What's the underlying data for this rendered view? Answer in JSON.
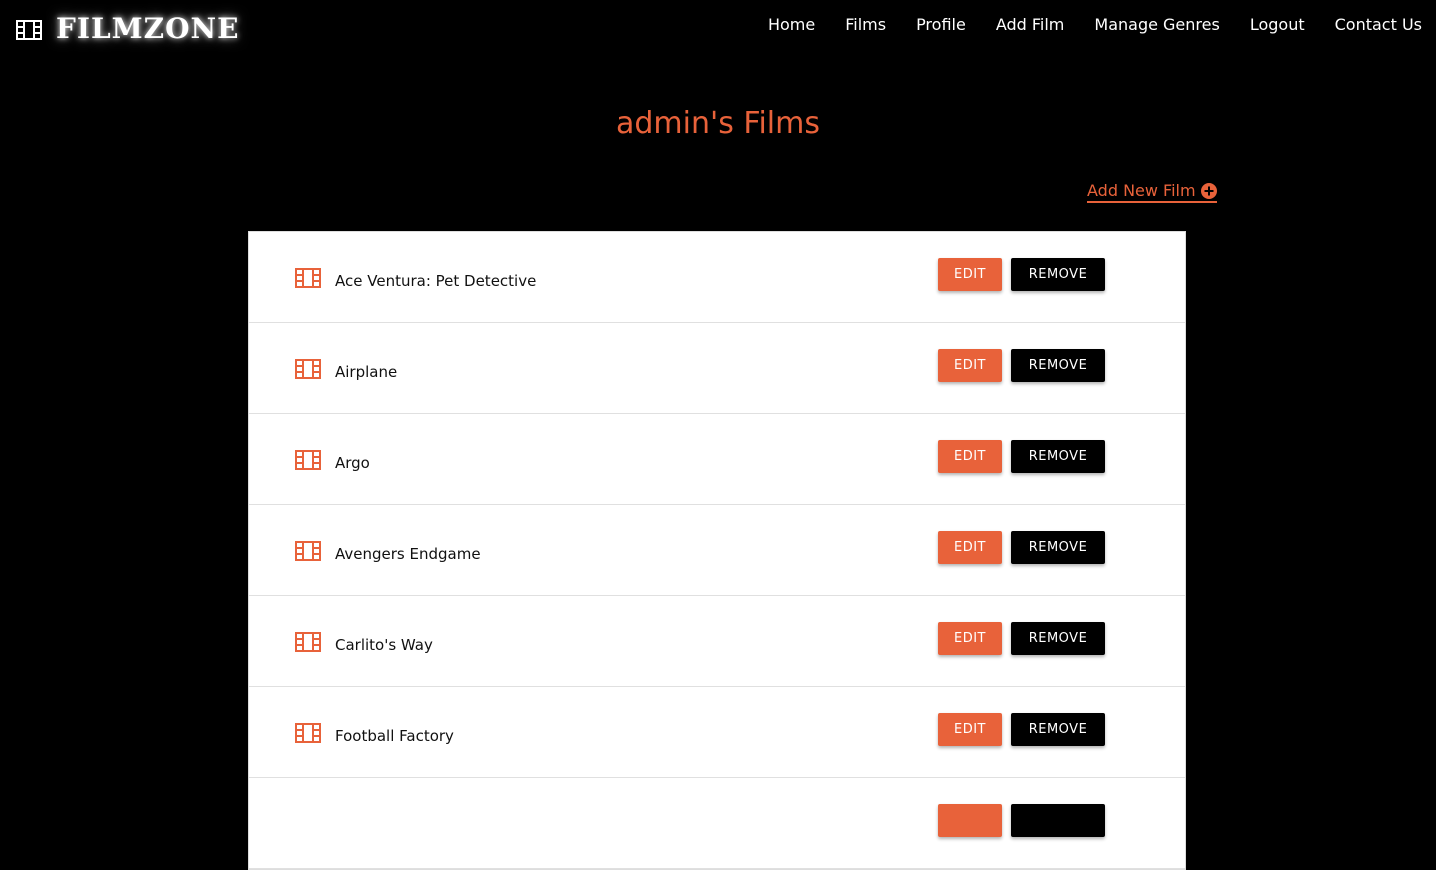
{
  "brand": {
    "name": "FILMZONE",
    "icon": "film-icon"
  },
  "nav": [
    {
      "label": "Home"
    },
    {
      "label": "Films"
    },
    {
      "label": "Profile"
    },
    {
      "label": "Add Film"
    },
    {
      "label": "Manage Genres"
    },
    {
      "label": "Logout"
    },
    {
      "label": "Contact Us"
    }
  ],
  "page": {
    "title": "admin's Films",
    "add_new_label": "Add New Film",
    "add_new_icon": "plus-circle-icon"
  },
  "films": [
    {
      "title": "Ace Ventura: Pet Detective",
      "edit_label": "EDIT",
      "remove_label": "REMOVE"
    },
    {
      "title": "Airplane",
      "edit_label": "EDIT",
      "remove_label": "REMOVE"
    },
    {
      "title": "Argo",
      "edit_label": "EDIT",
      "remove_label": "REMOVE"
    },
    {
      "title": "Avengers Endgame",
      "edit_label": "EDIT",
      "remove_label": "REMOVE"
    },
    {
      "title": "Carlito's Way",
      "edit_label": "EDIT",
      "remove_label": "REMOVE"
    },
    {
      "title": "Football Factory",
      "edit_label": "EDIT",
      "remove_label": "REMOVE"
    },
    {
      "title": "",
      "edit_label": "",
      "remove_label": ""
    }
  ],
  "colors": {
    "accent": "#e8623a",
    "background": "#000000",
    "card": "#ffffff"
  }
}
